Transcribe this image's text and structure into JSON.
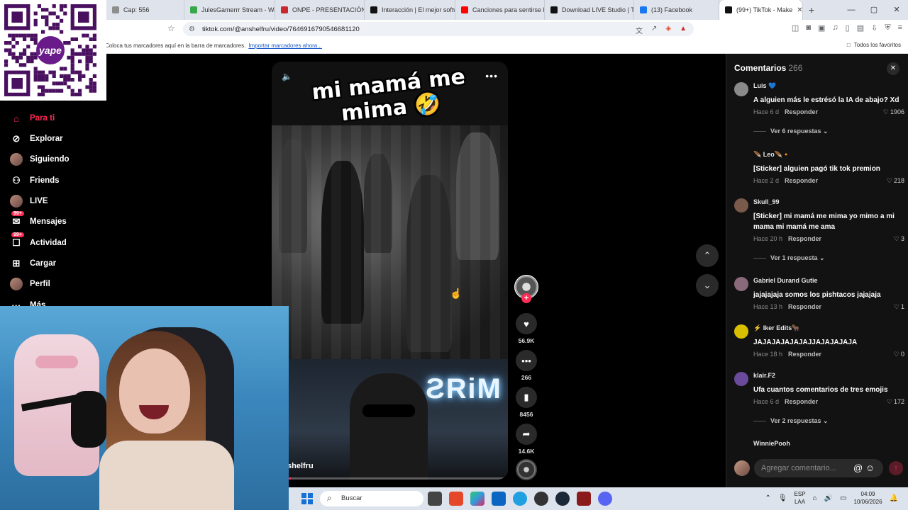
{
  "browser": {
    "tabs": [
      {
        "title": "Cap: 556",
        "color": "#8e8e8e"
      },
      {
        "title": "JulesGamerrr Stream - Wa",
        "color": "#36a84a"
      },
      {
        "title": "ONPE - PRESENTACIÓN D",
        "color": "#c8282e"
      },
      {
        "title": "Interacción | El mejor softw",
        "color": "#111111"
      },
      {
        "title": "Canciones para sentirse D",
        "color": "#ff0000"
      },
      {
        "title": "Download LIVE Studio | Ti",
        "color": "#111111"
      },
      {
        "title": "(13) Facebook",
        "color": "#1877f2"
      },
      {
        "title": "(99+) TikTok - Make",
        "color": "#111111",
        "active": true
      }
    ],
    "url": "tiktok.com/@anshelfru/video/7646916790546681120",
    "bookmarks_hint": "Coloca tus marcadores aquí en la barra de marcadores.",
    "bookmarks_import": "Importar marcadores ahora...",
    "all_favorites": "Todos los favoritos"
  },
  "sidebar": {
    "items": [
      {
        "label": "Para ti",
        "icon": "home-icon",
        "glyph": "⌂",
        "active": true
      },
      {
        "label": "Explorar",
        "icon": "compass-icon",
        "glyph": "⊘"
      },
      {
        "label": "Siguiendo",
        "icon": "avatar-icon",
        "glyph": ""
      },
      {
        "label": "Friends",
        "icon": "people-icon",
        "glyph": "⚇"
      },
      {
        "label": "LIVE",
        "icon": "live-avatar-icon",
        "glyph": ""
      },
      {
        "label": "Mensajes",
        "icon": "message-icon",
        "glyph": "✉",
        "badge": "99+"
      },
      {
        "label": "Actividad",
        "icon": "inbox-icon",
        "glyph": "☐",
        "badge": "99+"
      },
      {
        "label": "Cargar",
        "icon": "upload-icon",
        "glyph": "⊞"
      },
      {
        "label": "Perfil",
        "icon": "profile-avatar-icon",
        "glyph": ""
      },
      {
        "label": "Más",
        "icon": "more-icon",
        "glyph": "···"
      }
    ]
  },
  "video": {
    "caption_line1": "mi mamá me",
    "caption_line2": "mima 🤣",
    "handle_fragment": "shelfru",
    "neon_sign": "MiЯS",
    "progress_percent": 8
  },
  "actions": {
    "likes": "56.9K",
    "comments": "266",
    "saves": "8456",
    "shares": "14.6K"
  },
  "comments": {
    "title": "Comentarios",
    "count": "266",
    "items": [
      {
        "name": "Luis 💙",
        "text": "A alguien más le estrésó la IA de abajo? Xd",
        "time": "Hace 6 d",
        "reply": "Responder",
        "likes": "1906",
        "replies": "Ver 6 respuestas ⌄",
        "av": "#8a8a8a"
      },
      {
        "name": "🪶 Leo🪶🔸",
        "text": "[Sticker] alguien pagó tik tok premion",
        "time": "Hace 2 d",
        "reply": "Responder",
        "likes": "218",
        "av": "#121212"
      },
      {
        "name": "Skull_99",
        "text": "[Sticker] mi mamá me mima yo mimo a mi mama mi mamá me ama",
        "time": "Hace 20 h",
        "reply": "Responder",
        "likes": "3",
        "replies": "Ver 1 respuesta ⌄",
        "av": "#7a5a4a"
      },
      {
        "name": "Gabriel Durand Gutie",
        "text": "jajajajaja somos los pishtacos jajajaja",
        "time": "Hace 13 h",
        "reply": "Responder",
        "likes": "1",
        "av": "#8a6a7a"
      },
      {
        "name": "⚡ Iker Edits🐂",
        "text": "JAJAJAJAJAJAJJAJAJAJAJA",
        "time": "Hace 18 h",
        "reply": "Responder",
        "likes": "0",
        "av": "#d8c000"
      },
      {
        "name": "klair.F2",
        "text": "Ufa cuantos comentarios de tres emojis",
        "time": "Hace 6 d",
        "reply": "Responder",
        "likes": "172",
        "replies": "Ver 2 respuestas ⌄",
        "av": "#6a4a9a"
      },
      {
        "name": "WinniePooh",
        "text": "",
        "av": "#121212"
      }
    ],
    "input_placeholder": "Agregar comentario..."
  },
  "taskbar": {
    "search_placeholder": "Buscar",
    "lang_line1": "ESP",
    "lang_line2": "LAA",
    "time": "04:09",
    "date": "10/06/2026"
  },
  "colors": {
    "accent": "#fe2c55",
    "panel_bg": "#121212",
    "page_bg": "#000000"
  }
}
